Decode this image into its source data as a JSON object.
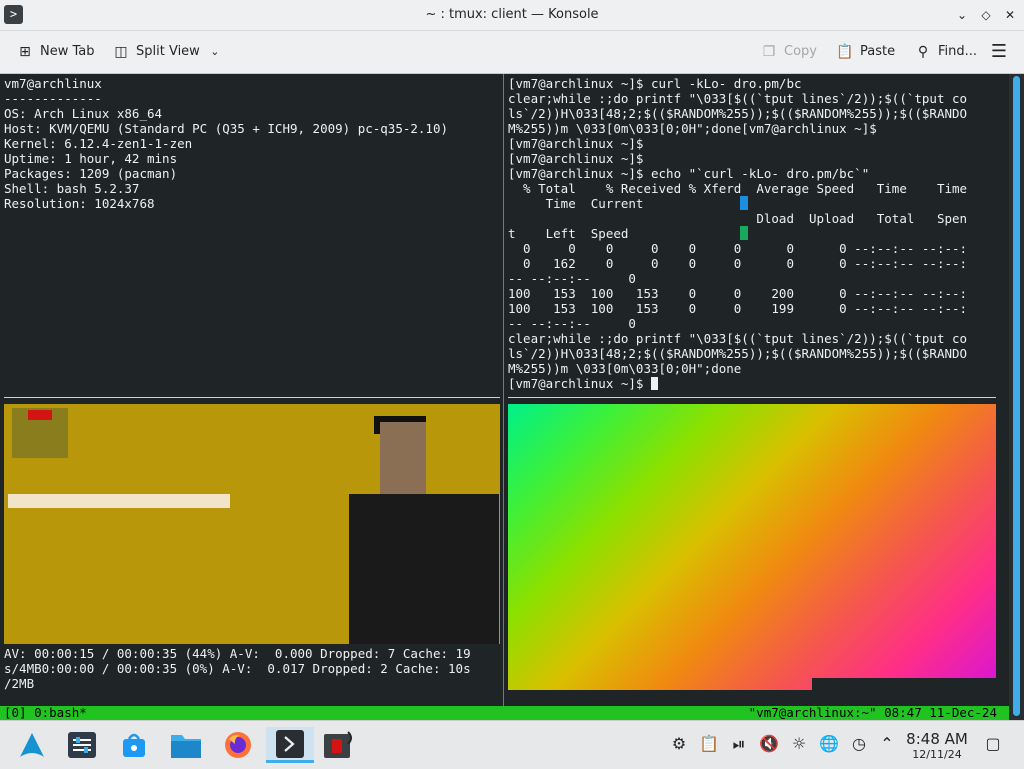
{
  "window": {
    "title": "~ : tmux: client — Konsole"
  },
  "toolbar": {
    "new_tab": "New Tab",
    "split_view": "Split View",
    "copy": "Copy",
    "paste": "Paste",
    "find": "Find..."
  },
  "panes": {
    "top_left": "vm7@archlinux\n-------------\nOS: Arch Linux x86_64\nHost: KVM/QEMU (Standard PC (Q35 + ICH9, 2009) pc-q35-2.10)\nKernel: 6.12.4-zen1-1-zen\nUptime: 1 hour, 42 mins\nPackages: 1209 (pacman)\nShell: bash 5.2.37\nResolution: 1024x768",
    "top_right": "[vm7@archlinux ~]$ curl -kLo- dro.pm/bc\nclear;while :;do printf \"\\033[$((`tput lines`/2));$((`tput co\nls`/2))H\\033[48;2;$(($RANDOM%255));$(($RANDOM%255));$(($RANDO\nM%255))m \\033[0m\\033[0;0H\";done[vm7@archlinux ~]$\n[vm7@archlinux ~]$\n[vm7@archlinux ~]$\n[vm7@archlinux ~]$ echo \"`curl -kLo- dro.pm/bc`\"\n  % Total    % Received % Xferd  Average Speed   Time    Time\n     Time  Current\n                                 Dload  Upload   Total   Spen\nt    Left  Speed\n  0     0    0     0    0     0      0      0 --:--:-- --:--:\n  0   162    0     0    0     0      0      0 --:--:-- --:--:\n-- --:--:--     0\n100   153  100   153    0     0    200      0 --:--:-- --:--:\n100   153  100   153    0     0    199      0 --:--:-- --:--:\n-- --:--:--     0\nclear;while :;do printf \"\\033[$((`tput lines`/2));$((`tput co\nls`/2))H\\033[48;2;$(($RANDOM%255));$(($RANDOM%255));$(($RANDO\nM%255))m \\033[0m\\033[0;0H\";done",
    "prompt": "[vm7@archlinux ~]$ ",
    "mpv_status": "AV: 00:00:15 / 00:00:35 (44%) A-V:  0.000 Dropped: 7 Cache: 19\ns/4MB0:00:00 / 00:00:35 (0%) A-V:  0.017 Dropped: 2 Cache: 10s\n/2MB"
  },
  "tmux_status": {
    "left": "[0] 0:bash*",
    "right": "\"vm7@archlinux:~\" 08:47 11-Dec-24"
  },
  "clock": {
    "time": "8:48 AM",
    "date": "12/11/24"
  },
  "colors": {
    "tmux_green": "#21c321",
    "accent": "#3daee9"
  },
  "taskbar_icons": [
    "arch-launcher-icon",
    "system-settings-icon",
    "discover-icon",
    "dolphin-icon",
    "firefox-icon",
    "konsole-icon",
    "media-player-icon"
  ],
  "tray_icons": [
    "steam-icon",
    "clipboard-icon",
    "media-pause-icon",
    "volume-muted-icon",
    "brightness-icon",
    "network-icon",
    "updates-icon",
    "expand-tray-icon",
    "show-desktop-icon"
  ]
}
